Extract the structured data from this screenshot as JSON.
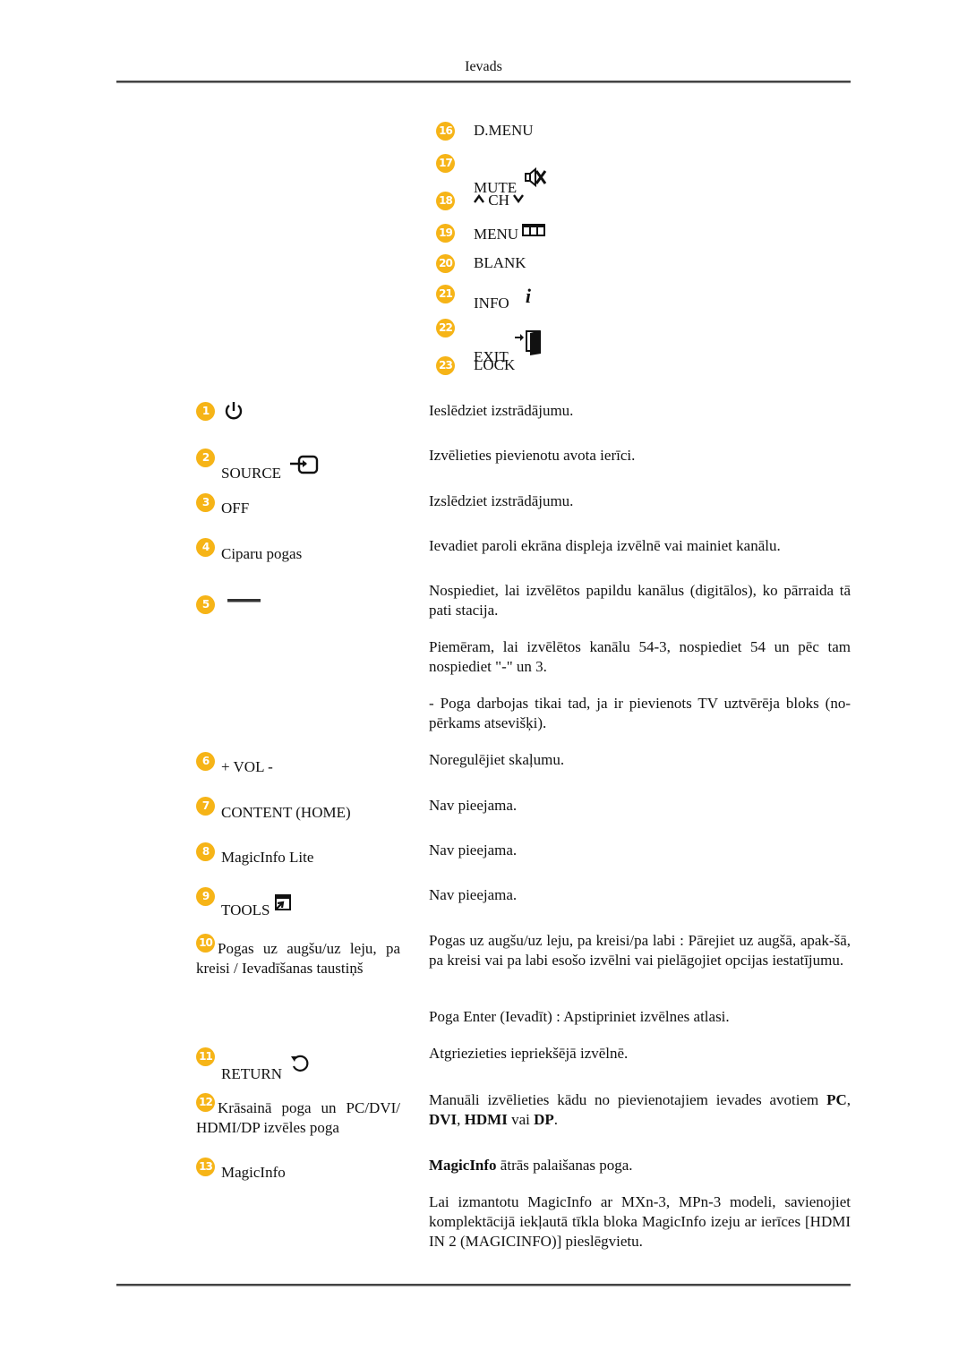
{
  "header": {
    "title": "Ievads"
  },
  "colors": {
    "badge": "#f6b417",
    "text": "#111111",
    "rule": "#444444"
  },
  "top_list": [
    {
      "num": "16",
      "label": "D.MENU",
      "icon": null
    },
    {
      "num": "17",
      "label": "MUTE",
      "icon": "mute-icon"
    },
    {
      "num": "18",
      "label": "CH",
      "icon": "channel-up-down-icon"
    },
    {
      "num": "19",
      "label": "MENU",
      "icon": "menu-icon"
    },
    {
      "num": "20",
      "label": "BLANK",
      "icon": null
    },
    {
      "num": "21",
      "label": "INFO",
      "icon": "info-icon"
    },
    {
      "num": "22",
      "label": "EXIT",
      "icon": "exit-icon"
    },
    {
      "num": "23",
      "label": "LOCK",
      "icon": null
    }
  ],
  "buttons": [
    {
      "num": "1",
      "label": "",
      "icon": "power-icon",
      "description": [
        "Ieslēdziet izstrādājumu."
      ]
    },
    {
      "num": "2",
      "label": "SOURCE",
      "icon": "source-icon",
      "description": [
        "Izvēlieties pievienotu avota ierīci."
      ]
    },
    {
      "num": "3",
      "label": "OFF",
      "icon": null,
      "description": [
        "Izslēdziet izstrādājumu."
      ]
    },
    {
      "num": "4",
      "label": "Ciparu pogas",
      "icon": null,
      "description": [
        "Ievadiet paroli ekrāna displeja izvēlnē vai mainiet kanālu."
      ]
    },
    {
      "num": "5",
      "label": "",
      "icon": "dash-icon",
      "description": [
        "Nospiediet, lai izvēlētos papildu kanālus (digitālos), ko pārraida tā pati stacija.",
        "Piemēram, lai izvēlētos kanālu 54-3, nospiediet 54 un pēc tam nospiediet \"-\" un 3.",
        "- Poga darbojas tikai tad, ja ir pievienots TV uztvērēja bloks (no-pērkams atsevišķi)."
      ]
    },
    {
      "num": "6",
      "label": "+ VOL -",
      "icon": null,
      "description": [
        "Noregulējiet skaļumu."
      ]
    },
    {
      "num": "7",
      "label": "CONTENT (HOME)",
      "icon": null,
      "description": [
        "Nav pieejama."
      ]
    },
    {
      "num": "8",
      "label": "MagicInfo Lite",
      "icon": null,
      "description": [
        "Nav pieejama."
      ]
    },
    {
      "num": "9",
      "label": "TOOLS",
      "icon": "tools-icon",
      "description": [
        "Nav pieejama."
      ]
    },
    {
      "num": "10",
      "label": "Pogas uz augšu/uz leju, pa kreisi / Ievadīšanas taustiņš",
      "icon": null,
      "description": [
        "Pogas uz augšu/uz leju, pa kreisi/pa labi : Pārejiet uz augšā, apak-šā, pa kreisi vai pa labi esošo izvēlni vai pielāgojiet opcijas iestatījumu.",
        "Poga Enter (Ievadīt) : Apstipriniet izvēlnes atlasi."
      ]
    },
    {
      "num": "11",
      "label": "RETURN",
      "icon": "return-icon",
      "description": [
        "Atgriezieties iepriekšējā izvēlnē."
      ]
    },
    {
      "num": "12",
      "label": "Krāsainā poga un PC/DVI/ HDMI/DP izvēles poga",
      "icon": null,
      "description": {
        "text1": "Manuāli izvēlieties kādu no pievienotajiem ievades avotiem ",
        "b1": "PC",
        "sep1": ", ",
        "b2": "DVI",
        "sep2": ", ",
        "b3": "HDMI",
        "sep3": " vai ",
        "b4": "DP",
        "end": "."
      }
    },
    {
      "num": "13",
      "label": "MagicInfo",
      "icon": null,
      "description": {
        "bold": "MagicInfo",
        "rest": " ātrās palaišanas poga.",
        "para2": "Lai izmantotu MagicInfo ar MXn-3, MPn-3 modeli, savienojiet komplektācijā iekļautā tīkla bloka MagicInfo izeju ar ierīces [HDMI IN 2 (MAGICINFO)] pieslēgvietu."
      }
    }
  ]
}
